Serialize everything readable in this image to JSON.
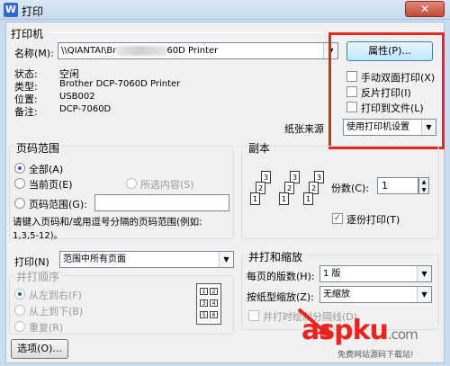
{
  "window": {
    "title": "打印",
    "app_icon": "W",
    "close_glyph": "✕"
  },
  "printer": {
    "group_label": "打印机",
    "name_label": "名称(M):",
    "name_prefix": "\\\\QIANTAI\\Br",
    "name_suffix": "60D Printer",
    "properties_button": "属性(P)...",
    "status_label": "状态:",
    "status_value": "空闲",
    "type_label": "类型:",
    "type_value": "Brother DCP-7060D Printer",
    "location_label": "位置:",
    "location_value": "USB002",
    "comment_label": "备注:",
    "comment_value": "DCP-7060D",
    "duplex_label": "手动双面打印(X)",
    "reverse_label": "反片打印(I)",
    "to_file_label": "打印到文件(L)",
    "paper_source_label": "纸张来源",
    "paper_source_value": "使用打印机设置"
  },
  "page_range": {
    "group_label": "页码范围",
    "all_label": "全部(A)",
    "current_label": "当前页(E)",
    "selection_label": "所选内容(S)",
    "pages_label": "页码范围(G):",
    "hint": "请键入页码和/或用逗号分隔的页码范围(例如:",
    "hint_example": "1,3,5-12)。"
  },
  "copies": {
    "group_label": "副本",
    "count_label": "份数(C):",
    "count_value": "1",
    "collate_label": "逐份打印(T)",
    "page_numbers": [
      "1",
      "2",
      "3"
    ]
  },
  "print_what": {
    "label": "打印(N)",
    "value": "范围中所有页面"
  },
  "print_order": {
    "group_label": "并打顺序",
    "left_to_right": "从左到右(F)",
    "top_to_bottom": "从上到下(B)",
    "repeat": "重复(R)",
    "grid_numbers": [
      "1",
      "2",
      "3",
      "4",
      "5",
      "6"
    ]
  },
  "zoom": {
    "group_label": "并打和缩放",
    "pages_per_sheet_label": "每页的版数(H):",
    "pages_per_sheet_value": "1 版",
    "scale_label": "按纸型缩放(Z):",
    "scale_value": "无缩放",
    "separator_label": "并打时绘制分隔线(D)"
  },
  "footer": {
    "options_button": "选项(O)...",
    "watermark": "aspku",
    "watermark_tld": ".com",
    "watermark_sub": "免费网站源码下载站!"
  },
  "colors": {
    "highlight": "#e8251f",
    "watermark": "#e8251f"
  }
}
